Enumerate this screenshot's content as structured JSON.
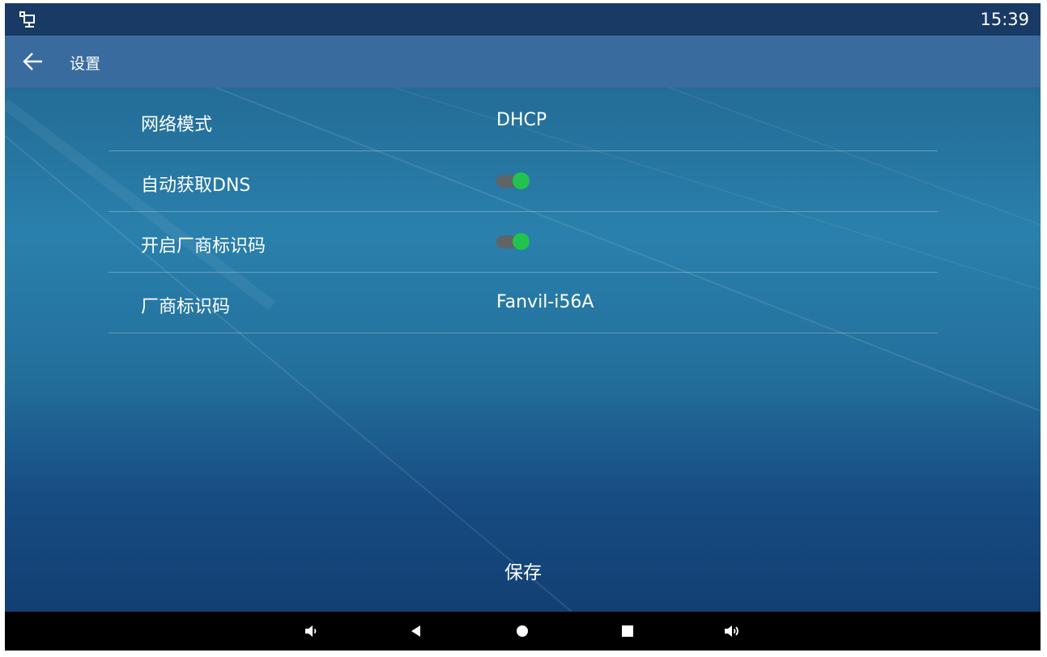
{
  "status_bar": {
    "time": "15:39",
    "network_icon": "network-icon"
  },
  "app_bar": {
    "back_icon": "back-arrow-icon",
    "title": "设置"
  },
  "settings": {
    "rows": [
      {
        "label": "网络模式",
        "value": "DHCP"
      },
      {
        "label": "自动获取DNS",
        "toggle": true
      },
      {
        "label": "开启厂商标识码",
        "toggle": true
      },
      {
        "label": "厂商标识码",
        "value": "Fanvil-i56A"
      }
    ]
  },
  "footer": {
    "save_label": "保存"
  },
  "nav_bar": {
    "icons": [
      "volume-down-icon",
      "back-triangle-icon",
      "home-circle-icon",
      "recents-square-icon",
      "volume-up-icon"
    ]
  },
  "colors": {
    "status_bar": "#193a65",
    "app_bar": "#3a6b9f",
    "toggle_on": "#22c24e",
    "toggle_track": "#5f6468"
  }
}
